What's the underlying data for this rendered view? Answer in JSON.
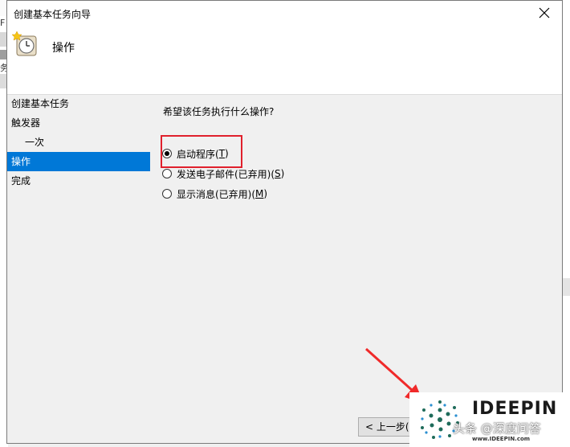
{
  "background": {
    "left_text1": "F",
    "left_text2": "务"
  },
  "window": {
    "title": "创建基本任务向导",
    "close_glyph": "✕"
  },
  "header": {
    "title": "操作"
  },
  "nav": {
    "items": [
      {
        "label": "创建基本任务"
      },
      {
        "label": "触发器"
      },
      {
        "label": "一次"
      },
      {
        "label": "操作"
      },
      {
        "label": "完成"
      }
    ]
  },
  "content": {
    "question": "希望该任务执行什么操作?",
    "options": [
      {
        "label": "启动程序(",
        "key": "T",
        "suffix": ")",
        "checked": true
      },
      {
        "label": "发送电子邮件(已弃用)(",
        "key": "S",
        "suffix": ")",
        "checked": false
      },
      {
        "label": "显示消息(已弃用)(",
        "key": "M",
        "suffix": ")",
        "checked": false
      }
    ]
  },
  "buttons": {
    "back": "< 上一步(B"
  },
  "watermark": {
    "brand": "IDEEPIN",
    "caption": "头条 @深度问答",
    "small": "www.IDEEPIN.com"
  },
  "colors": {
    "accent": "#0078d7",
    "highlight": "#e0202c"
  }
}
